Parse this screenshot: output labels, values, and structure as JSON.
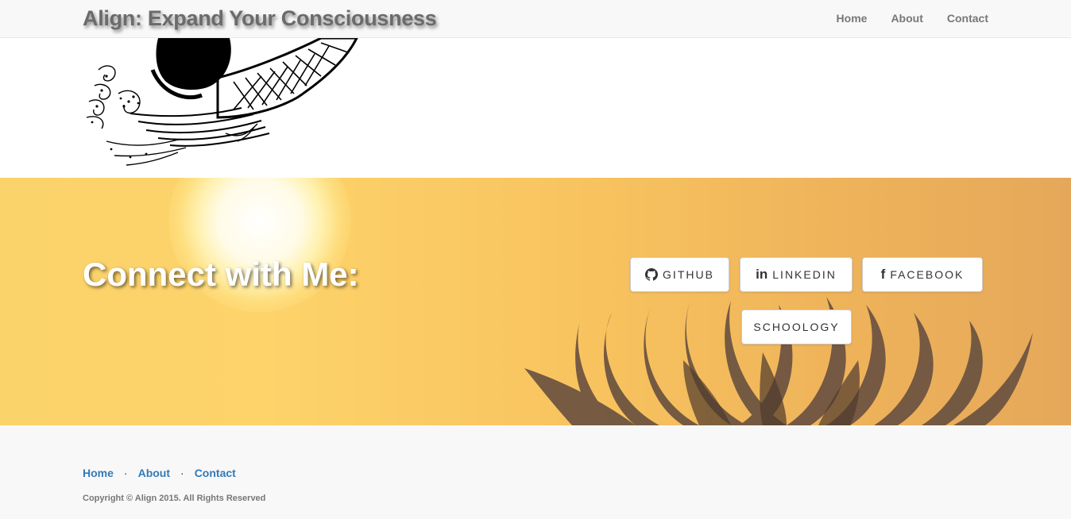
{
  "navbar": {
    "brand": "Align: Expand Your Consciousness",
    "links": [
      "Home",
      "About",
      "Contact"
    ]
  },
  "illustration": {
    "icon": "koi-fish-illustration"
  },
  "banner": {
    "title": "Connect with Me:",
    "buttons": [
      {
        "label": "GITHUB",
        "icon": "github-icon"
      },
      {
        "label": "LINKEDIN",
        "icon": "linkedin-icon",
        "glyph": "in"
      },
      {
        "label": "FACEBOOK",
        "icon": "facebook-icon",
        "glyph": "f"
      },
      {
        "label": "SCHOOLOGY"
      }
    ],
    "colors": {
      "sky_start": "#fbd36b",
      "sky_end": "#e5a85a",
      "lotus": "#6b5240"
    }
  },
  "footer": {
    "links": [
      "Home",
      "About",
      "Contact"
    ],
    "separator": "·",
    "copyright": "Copyright © Align 2015. All Rights Reserved"
  }
}
